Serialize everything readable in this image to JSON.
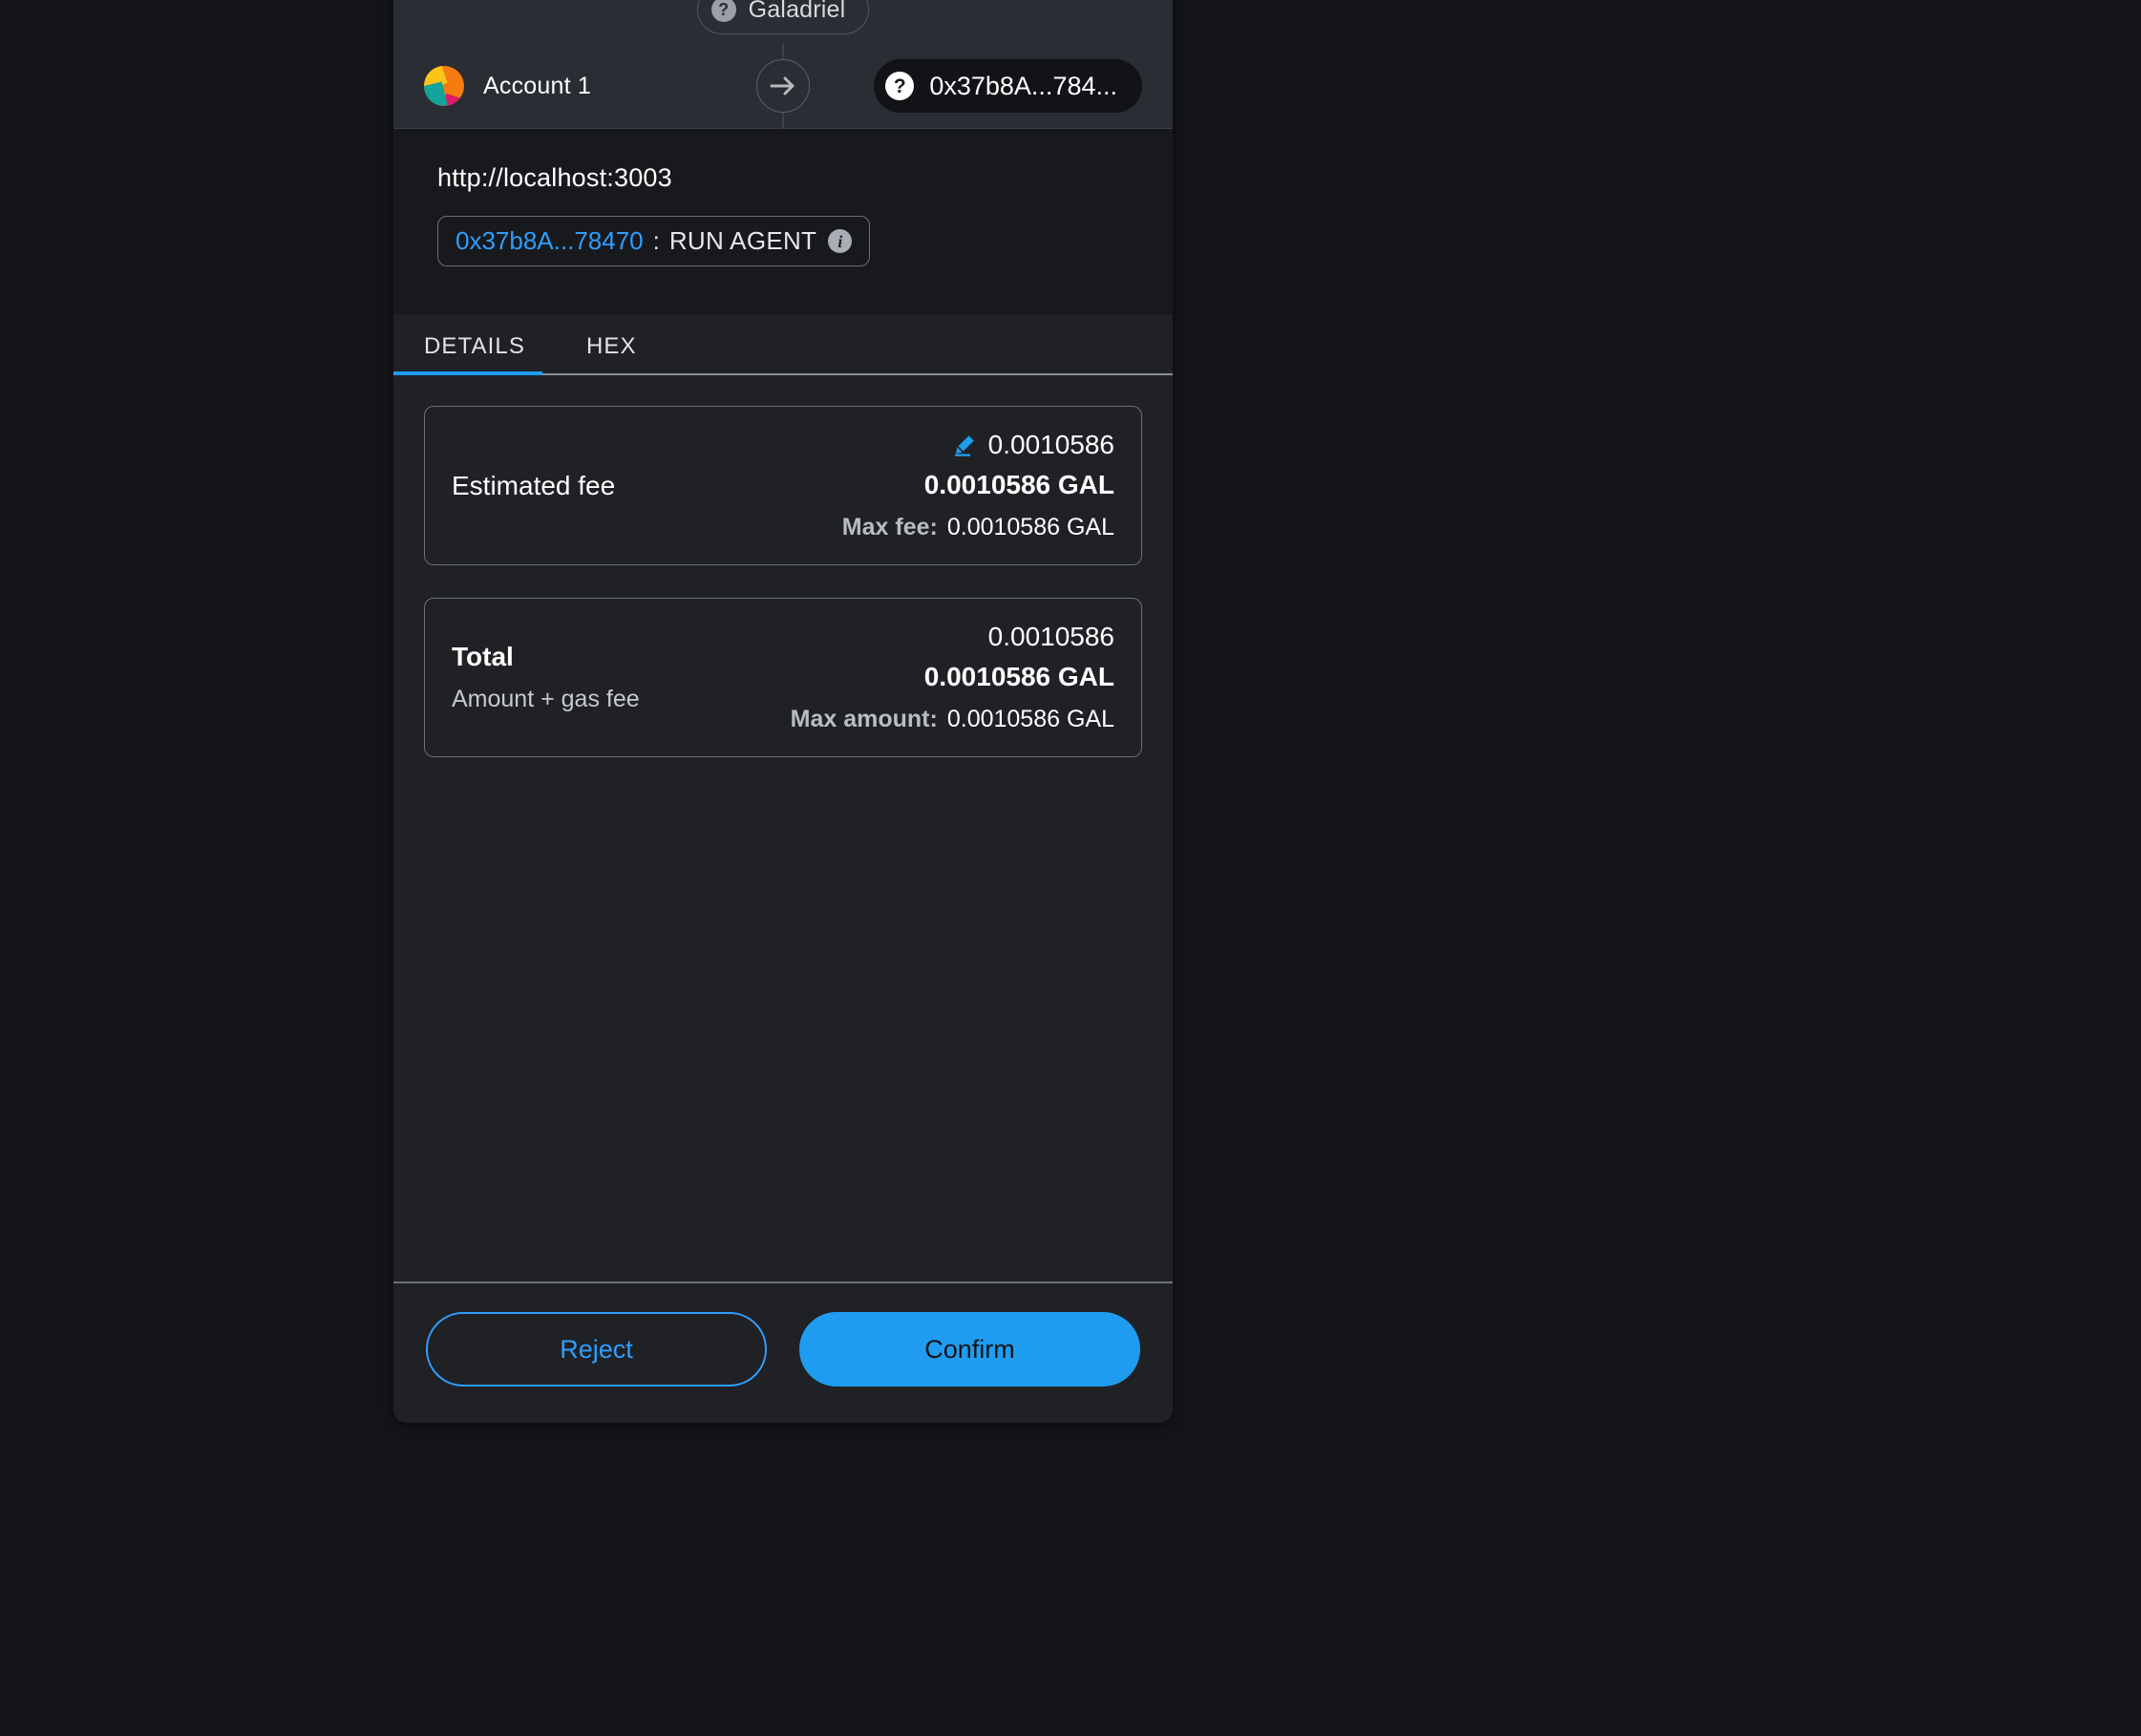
{
  "wallet": {
    "network": {
      "name": "Galadriel",
      "icon": "question-mark-icon"
    },
    "account": {
      "name": "Account 1",
      "avatar_icon": "account-identicon"
    },
    "transfer_arrow_icon": "arrow-right-icon",
    "recipient": {
      "address": "0x37b8A...784...",
      "icon": "question-mark-icon"
    }
  },
  "origin": {
    "url": "http://localhost:3003",
    "contract": {
      "address": "0x37b8A...78470",
      "separator": ":",
      "action": "RUN AGENT",
      "info_icon": "info-icon"
    },
    "contract_avatar_icon": "contract-identicon"
  },
  "tabs": [
    {
      "label": "DETAILS",
      "active": true
    },
    {
      "label": "HEX",
      "active": false
    }
  ],
  "details": {
    "estimated_fee": {
      "label": "Estimated fee",
      "edit_icon": "pencil-edit-icon",
      "amount": "0.0010586",
      "amount_currency": "0.0010586 GAL",
      "max_key": "Max fee:",
      "max_value": "0.0010586 GAL"
    },
    "total": {
      "label": "Total",
      "sublabel": "Amount + gas fee",
      "amount": "0.0010586",
      "amount_currency": "0.0010586 GAL",
      "max_key": "Max amount:",
      "max_value": "0.0010586 GAL"
    }
  },
  "footer": {
    "reject_label": "Reject",
    "confirm_label": "Confirm"
  },
  "colors": {
    "accent_blue": "#1f9cf0",
    "link_blue": "#2f9eff",
    "panel_bg": "#1f2125",
    "header_bg": "#2a2d33",
    "origin_bg": "#18191d",
    "page_bg": "#141518"
  }
}
